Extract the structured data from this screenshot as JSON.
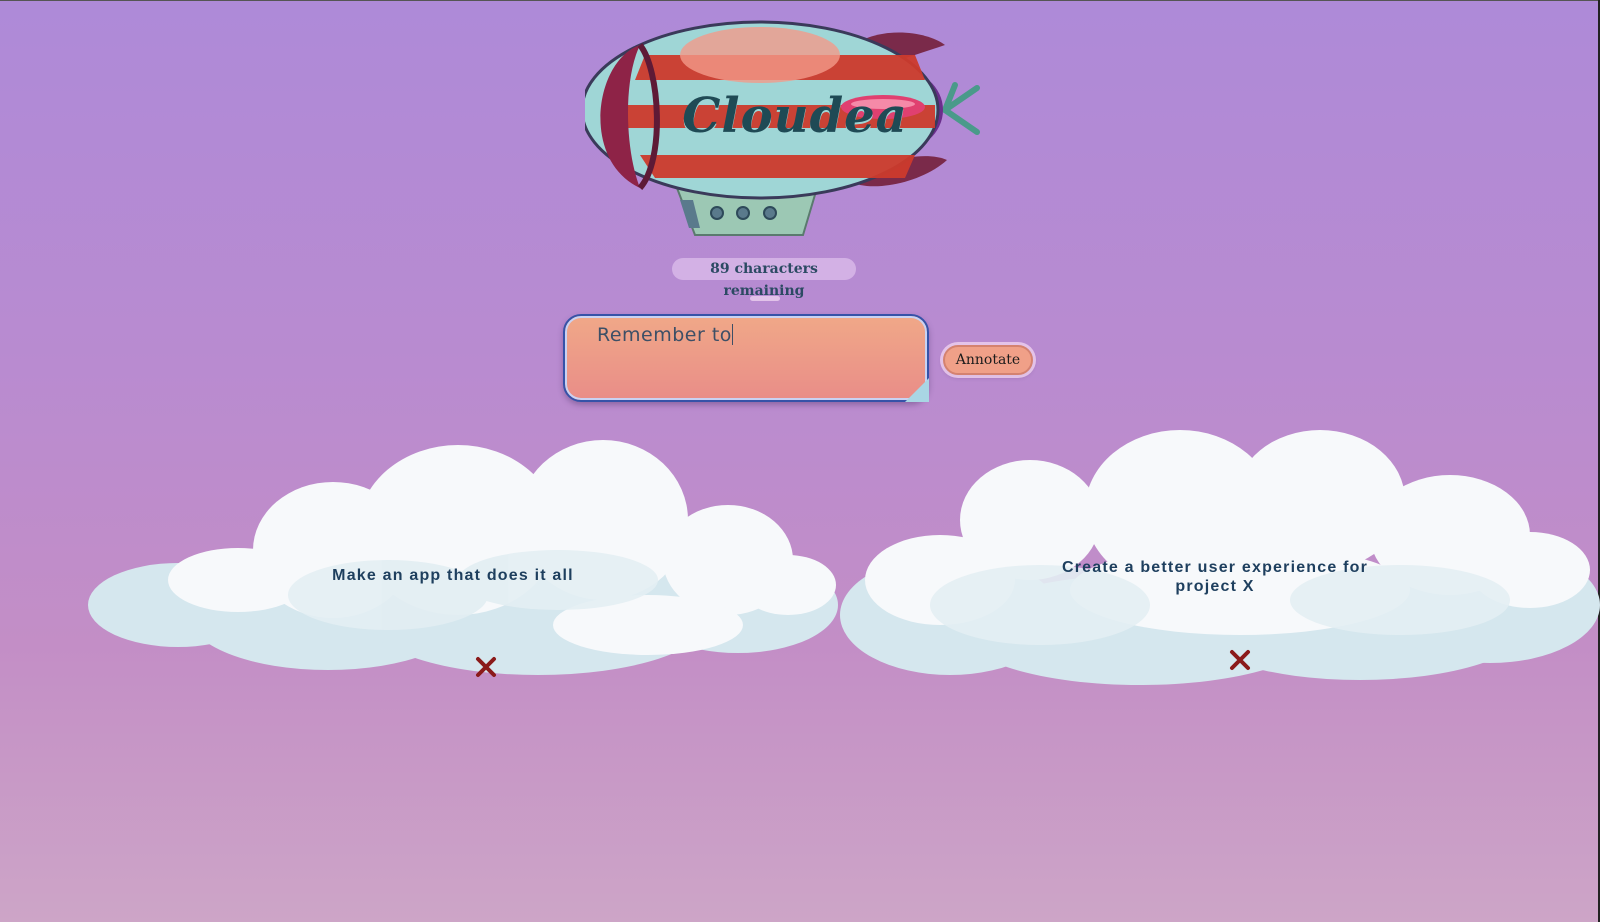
{
  "app": {
    "logo_text": "Cloudea"
  },
  "composer": {
    "chars_remaining": "89 characters remaining",
    "input_value": "Remember to",
    "submit_label": "Annotate"
  },
  "notes": [
    {
      "text": "Make an app that does it all"
    },
    {
      "text": "Create a better user experience for project X"
    }
  ],
  "colors": {
    "background_top": "#ae8ad8",
    "background_bottom": "#cda5c7",
    "input_fill": "#f0a888",
    "button_fill": "#f0a088",
    "note_text": "#1e3f5e",
    "delete_icon": "#8b1a1a"
  },
  "icons": [
    "blimp-logo-icon",
    "resize-handle-icon",
    "delete-icon"
  ]
}
